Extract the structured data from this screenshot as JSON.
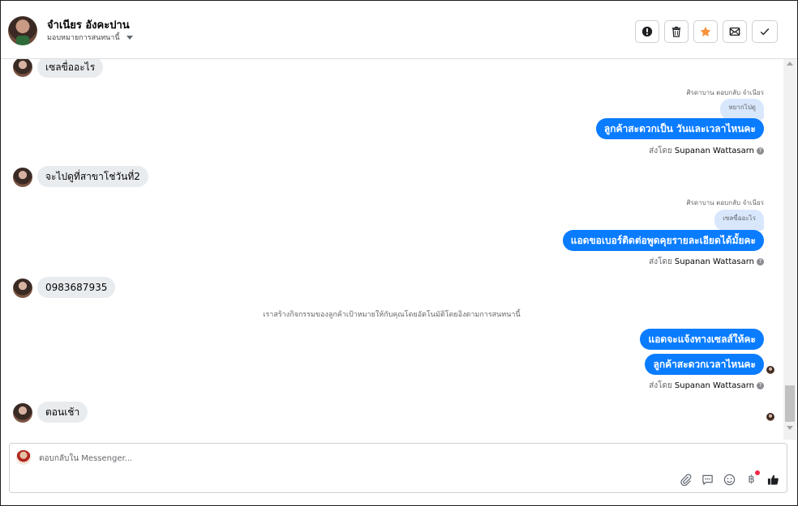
{
  "header": {
    "contact_name": "จำเนียร อังคะปาน",
    "assign_label": "มอบหมายการสนทนานี้",
    "actions": [
      {
        "name": "mark-spam",
        "icon": "alert-icon"
      },
      {
        "name": "delete",
        "icon": "trash-icon"
      },
      {
        "name": "star",
        "icon": "star-icon"
      },
      {
        "name": "mark-unread",
        "icon": "envelope-icon"
      },
      {
        "name": "mark-done",
        "icon": "check-icon"
      }
    ]
  },
  "messages": {
    "m1_in": "เซลขื่ออะไร",
    "r1_meta": "ศิรดาบาน ตอบกลับ จำเนียร",
    "r1_quoted": "หยากไปดู",
    "r1_text": "ลูกค้าสะดวกเป็น วันและเวลาไหนคะ",
    "r1_sent_prefix": "ส่งโดย",
    "r1_sender": "Supanan Wattasarn",
    "m2_in": "จะไปดูที่สาขาโช่วันที่2",
    "r2_meta": "ศิรดาบาน ตอบกลับ จำเนียร",
    "r2_quoted": "เซลขื่ออะไร",
    "r2_text": "แอดขอเบอร์ติดต่อพูดคุยรายละเอียดได้มั้ยคะ",
    "r2_sent_prefix": "ส่งโดย",
    "r2_sender": "Supanan Wattasarn",
    "m3_in": "0983687935",
    "system_note": "เราสร้างกิจกรรมของลูกค้าเป้าหมายให้กับคุณโดยอัตโนมัติโดยอิงตามการสนทนานี้",
    "r3_text1": "แอดจะแจ้งทางเซลส์ให้คะ",
    "r3_text2": "ลูกค้าสะดวกเวลาไหนคะ",
    "r3_sent_prefix": "ส่งโดย",
    "r3_sender": "Supanan Wattasarn",
    "m4_in": "ตอนเช้า"
  },
  "composer": {
    "placeholder": "ตอบกลับใน Messenger...",
    "tools": [
      "paperclip-icon",
      "saved-reply-icon",
      "emoji-icon",
      "baht-icon",
      "thumbs-up-icon"
    ],
    "baht_glyph": "฿"
  }
}
